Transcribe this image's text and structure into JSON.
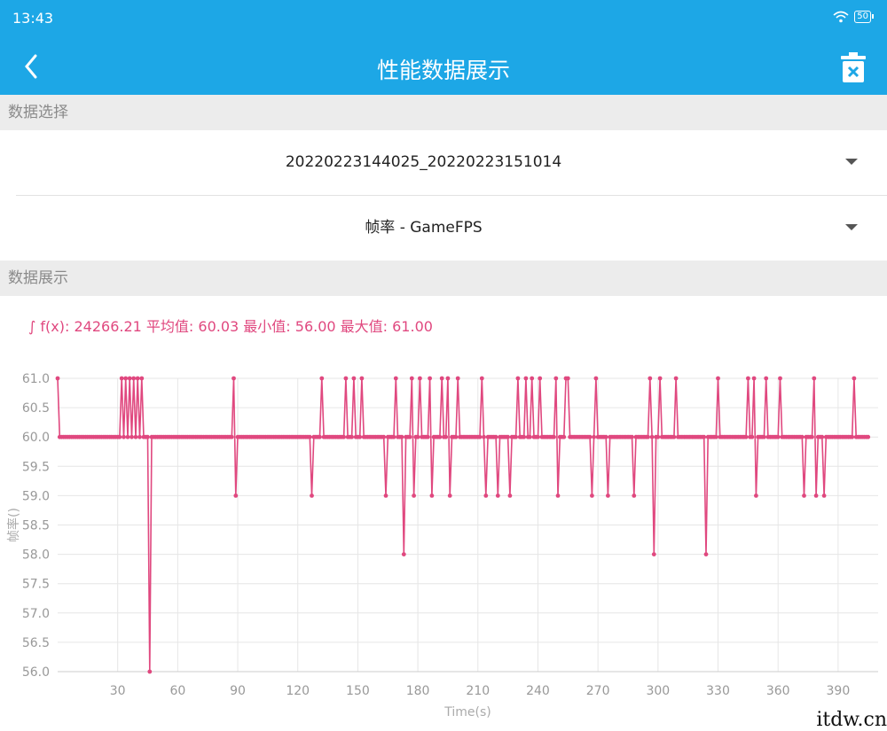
{
  "status_bar": {
    "time": "13:43",
    "battery": "50"
  },
  "app_bar": {
    "title": "性能数据展示",
    "back_icon": "chevron-left-icon",
    "delete_icon": "trash-icon"
  },
  "sections": {
    "data_select": "数据选择",
    "data_display": "数据展示"
  },
  "selects": {
    "session": "20220223144025_20220223151014",
    "metric": "帧率 - GameFPS"
  },
  "stats": "∫ f(x): 24266.21 平均值: 60.03 最小值: 56.00 最大值: 61.00",
  "watermark": "itdw.cn",
  "colors": {
    "accent": "#1da7e6",
    "series": "#e0487f"
  },
  "chart_data": {
    "type": "line",
    "xlabel": "Time(s)",
    "ylabel": "帧率()",
    "ylim": [
      56.0,
      61.0
    ],
    "xlim": [
      0,
      410
    ],
    "xticks": [
      30,
      60,
      90,
      120,
      150,
      180,
      210,
      240,
      270,
      300,
      330,
      360,
      390
    ],
    "yticks": [
      "61.0",
      "60.5",
      "60.0",
      "59.5",
      "59.0",
      "58.5",
      "58.0",
      "57.5",
      "57.0",
      "56.5",
      "56.0"
    ],
    "series": [
      {
        "values": [
          61,
          60,
          60,
          60,
          60,
          60,
          60,
          60,
          60,
          60,
          60,
          60,
          60,
          60,
          60,
          60,
          60,
          60,
          60,
          60,
          60,
          60,
          60,
          60,
          60,
          60,
          60,
          60,
          60,
          60,
          60,
          60,
          61,
          60,
          61,
          60,
          61,
          60,
          61,
          60,
          61,
          60,
          61,
          60,
          60,
          60,
          56,
          60,
          60,
          60,
          60,
          60,
          60,
          60,
          60,
          60,
          60,
          60,
          60,
          60,
          60,
          60,
          60,
          60,
          60,
          60,
          60,
          60,
          60,
          60,
          60,
          60,
          60,
          60,
          60,
          60,
          60,
          60,
          60,
          60,
          60,
          60,
          60,
          60,
          60,
          60,
          60,
          60,
          61,
          59,
          60,
          60,
          60,
          60,
          60,
          60,
          60,
          60,
          60,
          60,
          60,
          60,
          60,
          60,
          60,
          60,
          60,
          60,
          60,
          60,
          60,
          60,
          60,
          60,
          60,
          60,
          60,
          60,
          60,
          60,
          60,
          60,
          60,
          60,
          60,
          60,
          60,
          59,
          60,
          60,
          60,
          60,
          61,
          60,
          60,
          60,
          60,
          60,
          60,
          60,
          60,
          60,
          60,
          60,
          61,
          60,
          60,
          60,
          61,
          60,
          60,
          60,
          61,
          60,
          60,
          60,
          60,
          60,
          60,
          60,
          60,
          60,
          60,
          60,
          59,
          60,
          60,
          60,
          60,
          61,
          60,
          60,
          60,
          58,
          60,
          60,
          60,
          61,
          59,
          60,
          60,
          61,
          60,
          60,
          60,
          60,
          61,
          59,
          60,
          60,
          60,
          60,
          61,
          60,
          60,
          61,
          59,
          60,
          60,
          60,
          61,
          60,
          60,
          60,
          60,
          60,
          60,
          60,
          60,
          60,
          60,
          60,
          61,
          60,
          59,
          60,
          60,
          60,
          60,
          60,
          59,
          60,
          60,
          60,
          60,
          60,
          59,
          60,
          60,
          60,
          61,
          60,
          60,
          60,
          61,
          60,
          60,
          61,
          60,
          60,
          60,
          61,
          60,
          60,
          60,
          60,
          60,
          60,
          60,
          61,
          59,
          60,
          60,
          60,
          61,
          61,
          60,
          60,
          60,
          60,
          60,
          60,
          60,
          60,
          60,
          60,
          60,
          59,
          60,
          61,
          60,
          60,
          60,
          60,
          60,
          59,
          60,
          60,
          60,
          60,
          60,
          60,
          60,
          60,
          60,
          60,
          60,
          60,
          59,
          60,
          60,
          60,
          60,
          60,
          60,
          60,
          61,
          60,
          58,
          60,
          60,
          61,
          60,
          60,
          60,
          60,
          60,
          60,
          60,
          61,
          60,
          60,
          60,
          60,
          60,
          60,
          60,
          60,
          60,
          60,
          60,
          60,
          60,
          60,
          58,
          60,
          60,
          60,
          60,
          60,
          61,
          60,
          60,
          60,
          60,
          60,
          60,
          60,
          60,
          60,
          60,
          60,
          60,
          60,
          60,
          61,
          60,
          60,
          61,
          59,
          60,
          60,
          60,
          60,
          61,
          60,
          60,
          60,
          60,
          60,
          60,
          61,
          60,
          60,
          60,
          60,
          60,
          60,
          60,
          60,
          60,
          60,
          60,
          59,
          60,
          60,
          60,
          60,
          61,
          59,
          60,
          60,
          60,
          59,
          60,
          60,
          60,
          60,
          60,
          60,
          60,
          60,
          60,
          60,
          60,
          60,
          60,
          60,
          61,
          60,
          60,
          60,
          60,
          60,
          60,
          60
        ]
      }
    ]
  }
}
